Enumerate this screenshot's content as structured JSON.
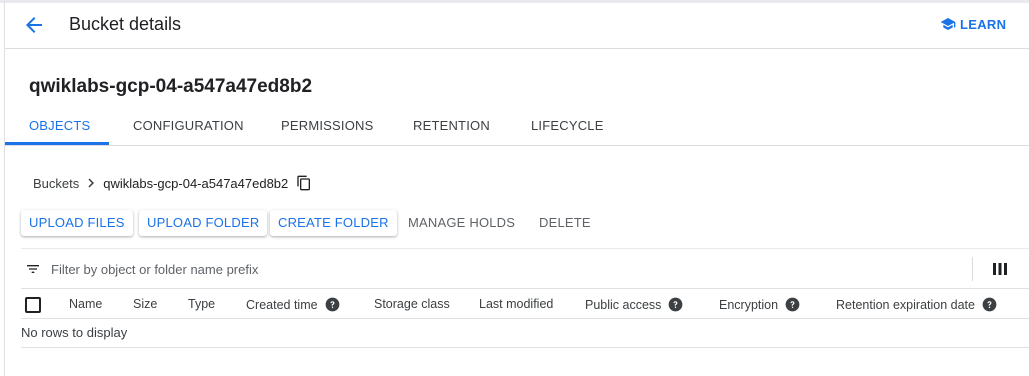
{
  "header": {
    "title": "Bucket details",
    "learn_label": "LEARN"
  },
  "bucket": {
    "name": "qwiklabs-gcp-04-a547a47ed8b2"
  },
  "tabs": [
    {
      "label": "OBJECTS",
      "active": true
    },
    {
      "label": "CONFIGURATION",
      "active": false
    },
    {
      "label": "PERMISSIONS",
      "active": false
    },
    {
      "label": "RETENTION",
      "active": false
    },
    {
      "label": "LIFECYCLE",
      "active": false
    }
  ],
  "breadcrumb": {
    "root": "Buckets",
    "current": "qwiklabs-gcp-04-a547a47ed8b2"
  },
  "actions": {
    "upload_files": "UPLOAD FILES",
    "upload_folder": "UPLOAD FOLDER",
    "create_folder": "CREATE FOLDER",
    "manage_holds": "MANAGE HOLDS",
    "delete": "DELETE"
  },
  "filter": {
    "placeholder": "Filter by object or folder name prefix",
    "value": ""
  },
  "table": {
    "columns": [
      {
        "label": "Name",
        "help": false
      },
      {
        "label": "Size",
        "help": false
      },
      {
        "label": "Type",
        "help": false
      },
      {
        "label": "Created time",
        "help": true
      },
      {
        "label": "Storage class",
        "help": false
      },
      {
        "label": "Last modified",
        "help": false
      },
      {
        "label": "Public access",
        "help": true
      },
      {
        "label": "Encryption",
        "help": true
      },
      {
        "label": "Retention expiration date",
        "help": true
      }
    ],
    "empty_message": "No rows to display"
  },
  "icons": {
    "back": "arrow-back-icon",
    "learn": "school-icon",
    "chevron": "chevron-right-icon",
    "copy": "copy-icon",
    "filter": "filter-list-icon",
    "columns": "column-display-icon",
    "help": "help-circle-icon"
  },
  "colors": {
    "accent": "#1a73e8",
    "text": "#202124",
    "secondary_text": "#5f6368",
    "divider": "#dadce0"
  }
}
